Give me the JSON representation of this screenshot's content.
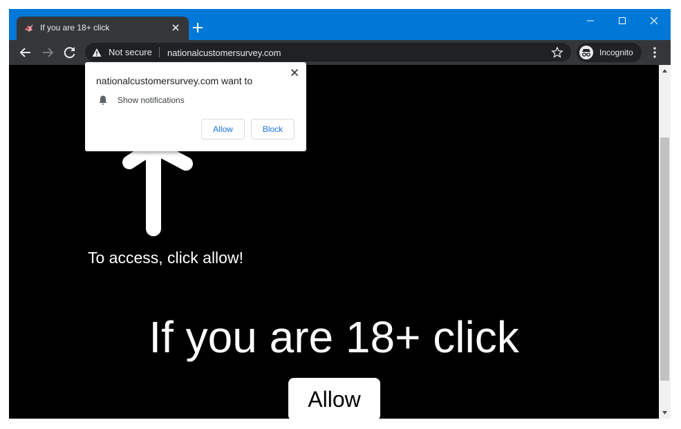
{
  "browser": {
    "tab": {
      "title": "If you are 18+ click"
    },
    "omnibox": {
      "security_label": "Not secure",
      "url": "nationalcustomersurvey.com"
    },
    "profile": {
      "label": "Incognito"
    }
  },
  "permission_prompt": {
    "title": "nationalcustomersurvey.com want to",
    "permission": "Show notifications",
    "allow_label": "Allow",
    "block_label": "Block"
  },
  "page": {
    "access_text": "To access, click allow!",
    "heading": "If you are 18+ click",
    "allow_button": "Allow"
  },
  "colors": {
    "title_bar": "#0078d7",
    "toolbar": "#35363a",
    "page_background": "#000000",
    "prompt_button_text": "#1a73e8"
  },
  "icons": {
    "tab_favicon": "favicon-icon",
    "tab_close": "close-icon",
    "new_tab": "plus-icon",
    "back": "back-arrow-icon",
    "forward": "forward-arrow-icon",
    "reload": "reload-icon",
    "security": "warning-icon",
    "bookmark": "star-icon",
    "incognito": "incognito-icon",
    "menu": "kebab-menu-icon",
    "notification": "bell-icon"
  }
}
